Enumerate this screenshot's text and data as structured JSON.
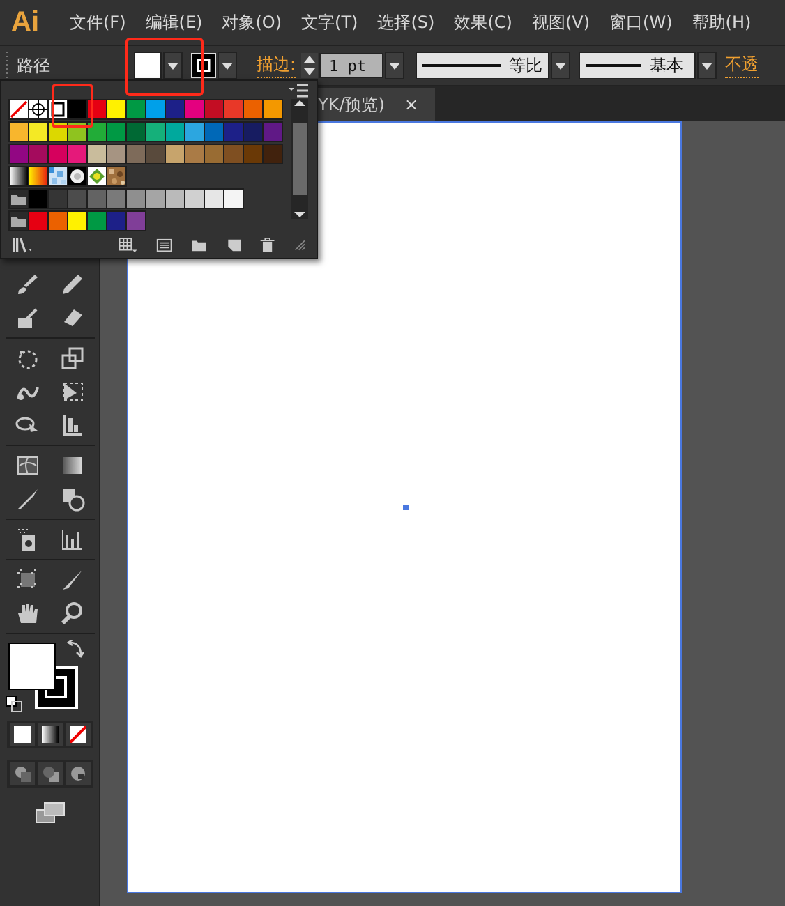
{
  "app": {
    "logo": "Ai"
  },
  "menu": [
    "文件(F)",
    "编辑(E)",
    "对象(O)",
    "文字(T)",
    "选择(S)",
    "效果(C)",
    "视图(V)",
    "窗口(W)",
    "帮助(H)"
  ],
  "control_bar": {
    "object_type": "路径",
    "stroke_label": "描边:",
    "stroke_weight": "1 pt",
    "width_profile": "等比",
    "brush": "基本",
    "opacity_label": "不透"
  },
  "document_tab": {
    "title": "YK/预览)",
    "close": "×"
  },
  "swatches_panel": {
    "rows": [
      {
        "folder": false,
        "swatches": [
          {
            "kind": "none",
            "selected": false
          },
          {
            "kind": "registration",
            "selected": false
          },
          {
            "kind": "color",
            "color": "#ffffff",
            "selected": true
          },
          {
            "kind": "color",
            "color": "#000000",
            "selected": false
          },
          {
            "kind": "color",
            "color": "#e60012",
            "selected": false
          },
          {
            "kind": "color",
            "color": "#fff100",
            "selected": false
          },
          {
            "kind": "color",
            "color": "#009944",
            "selected": false
          },
          {
            "kind": "color",
            "color": "#00a0e9",
            "selected": false
          },
          {
            "kind": "color",
            "color": "#1d2088",
            "selected": false
          },
          {
            "kind": "color",
            "color": "#e4007f",
            "selected": false
          },
          {
            "kind": "color",
            "color": "#c30d23",
            "selected": false
          },
          {
            "kind": "color",
            "color": "#e83828",
            "selected": false
          },
          {
            "kind": "color",
            "color": "#eb6100",
            "selected": false
          },
          {
            "kind": "color",
            "color": "#f39800",
            "selected": false
          }
        ]
      },
      {
        "folder": false,
        "swatches": [
          {
            "kind": "color",
            "color": "#f8b62d",
            "selected": false
          },
          {
            "kind": "color",
            "color": "#f4e925",
            "selected": false
          },
          {
            "kind": "color",
            "color": "#dcd800",
            "selected": false
          },
          {
            "kind": "color",
            "color": "#8fc31f",
            "selected": false
          },
          {
            "kind": "color",
            "color": "#22ac38",
            "selected": false
          },
          {
            "kind": "color",
            "color": "#009944",
            "selected": false
          },
          {
            "kind": "color",
            "color": "#006934",
            "selected": false
          },
          {
            "kind": "color",
            "color": "#15b07a",
            "selected": false
          },
          {
            "kind": "color",
            "color": "#00a99d",
            "selected": false
          },
          {
            "kind": "color",
            "color": "#2ca6e0",
            "selected": false
          },
          {
            "kind": "color",
            "color": "#0068b7",
            "selected": false
          },
          {
            "kind": "color",
            "color": "#1d2088",
            "selected": false
          },
          {
            "kind": "color",
            "color": "#171c61",
            "selected": false
          },
          {
            "kind": "color",
            "color": "#601986",
            "selected": false
          }
        ]
      },
      {
        "folder": false,
        "swatches": [
          {
            "kind": "color",
            "color": "#920783",
            "selected": false
          },
          {
            "kind": "color",
            "color": "#a40b5d",
            "selected": false
          },
          {
            "kind": "color",
            "color": "#d6005d",
            "selected": false
          },
          {
            "kind": "color",
            "color": "#e5197a",
            "selected": false
          },
          {
            "kind": "color",
            "color": "#c9bc9c",
            "selected": false
          },
          {
            "kind": "color",
            "color": "#a69482",
            "selected": false
          },
          {
            "kind": "color",
            "color": "#7e6b5a",
            "selected": false
          },
          {
            "kind": "color",
            "color": "#594a3c",
            "selected": false
          },
          {
            "kind": "color",
            "color": "#c7a46c",
            "selected": false
          },
          {
            "kind": "color",
            "color": "#aa7b46",
            "selected": false
          },
          {
            "kind": "color",
            "color": "#996c33",
            "selected": false
          },
          {
            "kind": "color",
            "color": "#7f4f21",
            "selected": false
          },
          {
            "kind": "color",
            "color": "#6a3906",
            "selected": false
          },
          {
            "kind": "color",
            "color": "#41220d",
            "selected": false
          }
        ]
      },
      {
        "folder": false,
        "swatches": [
          {
            "kind": "fade",
            "selected": false
          },
          {
            "kind": "spectrum",
            "selected": false
          },
          {
            "kind": "checker",
            "selected": false
          },
          {
            "kind": "halo",
            "selected": false
          },
          {
            "kind": "foliage",
            "selected": false
          },
          {
            "kind": "texture",
            "selected": false
          }
        ]
      },
      {
        "folder": true,
        "swatches": [
          {
            "kind": "color",
            "color": "#000000",
            "selected": false
          },
          {
            "kind": "color",
            "color": "#353535",
            "selected": false
          },
          {
            "kind": "color",
            "color": "#4c4c4c",
            "selected": false
          },
          {
            "kind": "color",
            "color": "#636363",
            "selected": false
          },
          {
            "kind": "color",
            "color": "#7a7a7a",
            "selected": false
          },
          {
            "kind": "color",
            "color": "#8f8f8f",
            "selected": false
          },
          {
            "kind": "color",
            "color": "#a5a5a5",
            "selected": false
          },
          {
            "kind": "color",
            "color": "#bababa",
            "selected": false
          },
          {
            "kind": "color",
            "color": "#d0d0d0",
            "selected": false
          },
          {
            "kind": "color",
            "color": "#e6e6e6",
            "selected": false
          },
          {
            "kind": "color",
            "color": "#f4f4f4",
            "selected": false
          }
        ]
      },
      {
        "folder": true,
        "swatches": [
          {
            "kind": "color",
            "color": "#e60012",
            "selected": false
          },
          {
            "kind": "color",
            "color": "#eb6100",
            "selected": false
          },
          {
            "kind": "color",
            "color": "#fff100",
            "selected": false
          },
          {
            "kind": "color",
            "color": "#009944",
            "selected": false
          },
          {
            "kind": "color",
            "color": "#1d2088",
            "selected": false
          },
          {
            "kind": "color",
            "color": "#803e98",
            "selected": false
          }
        ]
      }
    ]
  }
}
